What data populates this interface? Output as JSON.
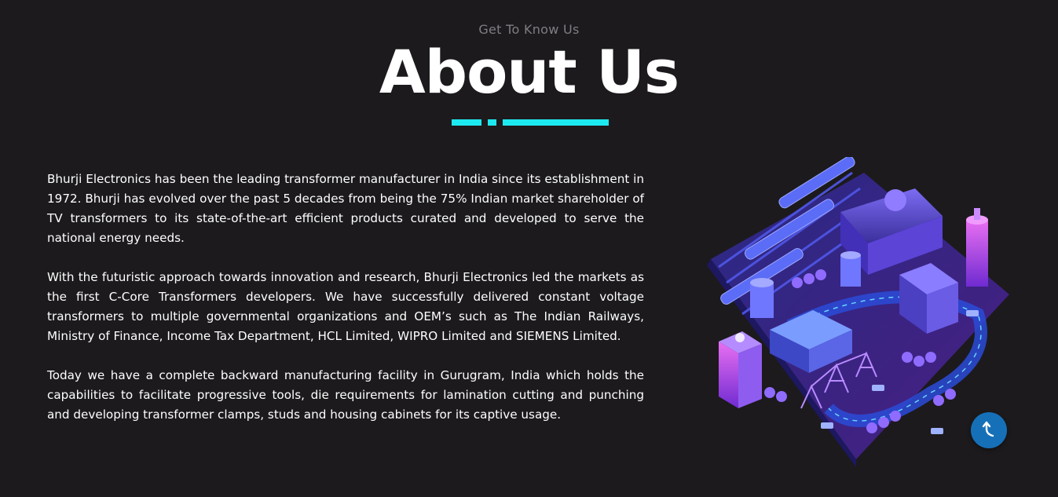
{
  "section": {
    "eyebrow": "Get To Know Us",
    "title": "About Us"
  },
  "accent_color": "#1de9f0",
  "paragraphs": [
    "Bhurji Electronics has been the leading transformer manufacturer in India since its establishment in 1972. Bhurji has evolved over the past 5 decades from being the 75% Indian market shareholder of TV transformers to its state-of-the-art efficient products curated and developed to serve the national energy needs.",
    "With the futuristic approach towards innovation and research, Bhurji Electronics led the markets as the first C-Core Transformers developers. We have successfully delivered constant voltage transformers to multiple governmental organizations and OEM’s such as The Indian Railways, Ministry of Finance, Income Tax Department, HCL Limited, WIPRO Limited and SIEMENS Limited.",
    "Today we have a complete backward manufacturing facility in Gurugram, India which holds the capabilities to facilitate progressive tools, die requirements for lamination cutting and punching and developing transformer clamps, studs and housing cabinets for its captive usage."
  ],
  "illustration": {
    "icon": "isometric-city-illustration"
  },
  "scroll_top": {
    "icon": "arrow-up-icon",
    "color": "#1670b8"
  }
}
